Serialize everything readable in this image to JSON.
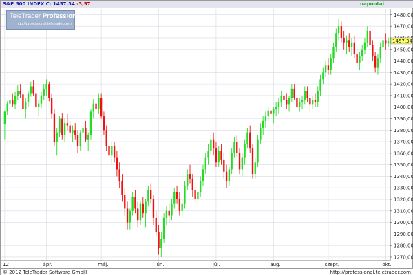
{
  "header": {
    "instrument": "S&P 500 INDEX",
    "close_prefix": "C: 1457,34",
    "change": "-3,57",
    "period": "napontai"
  },
  "logo": {
    "name_light": "TeleTrader",
    "name_bold": "Professional",
    "url": "http://professional.teletrader.com"
  },
  "footer": {
    "copyright": "© 2012 TeleTrader Software GmbH",
    "url": "http://professional.teletrader.com"
  },
  "colors": {
    "up": "#22dd22",
    "down": "#ee1111",
    "grid": "#d8d8e4",
    "last_price_bg": "#ffff66"
  },
  "chart_data": {
    "type": "candlestick",
    "ylim": [
      1267,
      1485
    ],
    "y_ticks": [
      1270,
      1280,
      1290,
      1300,
      1310,
      1320,
      1330,
      1340,
      1350,
      1360,
      1370,
      1380,
      1390,
      1400,
      1410,
      1420,
      1430,
      1440,
      1450,
      1460,
      1470,
      1480
    ],
    "y_tick_labels": [
      "1270,00",
      "1280,00",
      "1290,00",
      "1300,00",
      "1310,00",
      "1320,00",
      "1330,00",
      "1340,00",
      "1350,00",
      "1360,00",
      "1370,00",
      "1380,00",
      "1390,00",
      "1400,00",
      "1410,00",
      "1420,00",
      "1430,00",
      "1440,00",
      "1450,00",
      "1460,00",
      "1470,00",
      "1480,00"
    ],
    "x_months": [
      {
        "label": "12",
        "index": 0
      },
      {
        "label": "ápr.",
        "index": 16
      },
      {
        "label": "máj.",
        "index": 37
      },
      {
        "label": "jún.",
        "index": 59
      },
      {
        "label": "júl.",
        "index": 81
      },
      {
        "label": "aug.",
        "index": 103
      },
      {
        "label": "szept.",
        "index": 124
      },
      {
        "label": "okt.",
        "index": 146
      }
    ],
    "last_price": 1457.34,
    "last_price_label": "1457,34",
    "candles": [
      [
        1385,
        1397,
        1372,
        1396
      ],
      [
        1396,
        1405,
        1393,
        1403
      ],
      [
        1403,
        1409,
        1399,
        1406
      ],
      [
        1406,
        1412,
        1400,
        1402
      ],
      [
        1402,
        1413,
        1398,
        1410
      ],
      [
        1410,
        1419,
        1406,
        1414
      ],
      [
        1414,
        1420,
        1408,
        1411
      ],
      [
        1411,
        1416,
        1396,
        1398
      ],
      [
        1398,
        1408,
        1390,
        1404
      ],
      [
        1404,
        1414,
        1400,
        1412
      ],
      [
        1412,
        1422,
        1409,
        1418
      ],
      [
        1418,
        1423,
        1410,
        1412
      ],
      [
        1412,
        1418,
        1398,
        1400
      ],
      [
        1400,
        1406,
        1392,
        1403
      ],
      [
        1403,
        1413,
        1399,
        1410
      ],
      [
        1410,
        1420,
        1406,
        1416
      ],
      [
        1416,
        1424,
        1410,
        1420
      ],
      [
        1420,
        1422,
        1405,
        1408
      ],
      [
        1408,
        1412,
        1390,
        1394
      ],
      [
        1394,
        1398,
        1366,
        1370
      ],
      [
        1370,
        1382,
        1358,
        1378
      ],
      [
        1378,
        1392,
        1374,
        1390
      ],
      [
        1390,
        1395,
        1372,
        1376
      ],
      [
        1376,
        1390,
        1370,
        1386
      ],
      [
        1386,
        1394,
        1380,
        1384
      ],
      [
        1384,
        1388,
        1374,
        1378
      ],
      [
        1378,
        1384,
        1370,
        1380
      ],
      [
        1380,
        1386,
        1372,
        1376
      ],
      [
        1376,
        1380,
        1360,
        1366
      ],
      [
        1366,
        1380,
        1362,
        1378
      ],
      [
        1378,
        1386,
        1374,
        1382
      ],
      [
        1382,
        1388,
        1370,
        1372
      ],
      [
        1372,
        1378,
        1362,
        1376
      ],
      [
        1376,
        1398,
        1372,
        1396
      ],
      [
        1396,
        1407,
        1390,
        1403
      ],
      [
        1403,
        1410,
        1395,
        1398
      ],
      [
        1398,
        1412,
        1394,
        1408
      ],
      [
        1408,
        1412,
        1390,
        1392
      ],
      [
        1392,
        1396,
        1376,
        1380
      ],
      [
        1380,
        1384,
        1362,
        1366
      ],
      [
        1366,
        1372,
        1352,
        1358
      ],
      [
        1358,
        1370,
        1350,
        1366
      ],
      [
        1366,
        1370,
        1352,
        1356
      ],
      [
        1356,
        1362,
        1340,
        1346
      ],
      [
        1346,
        1352,
        1330,
        1336
      ],
      [
        1336,
        1342,
        1318,
        1324
      ],
      [
        1324,
        1330,
        1306,
        1312
      ],
      [
        1312,
        1318,
        1294,
        1300
      ],
      [
        1300,
        1312,
        1294,
        1310
      ],
      [
        1310,
        1326,
        1306,
        1322
      ],
      [
        1322,
        1328,
        1308,
        1312
      ],
      [
        1312,
        1318,
        1296,
        1302
      ],
      [
        1302,
        1318,
        1298,
        1316
      ],
      [
        1316,
        1322,
        1304,
        1308
      ],
      [
        1308,
        1320,
        1296,
        1318
      ],
      [
        1318,
        1332,
        1314,
        1328
      ],
      [
        1328,
        1334,
        1316,
        1320
      ],
      [
        1320,
        1324,
        1298,
        1304
      ],
      [
        1304,
        1310,
        1288,
        1292
      ],
      [
        1292,
        1298,
        1272,
        1278
      ],
      [
        1278,
        1292,
        1270,
        1286
      ],
      [
        1286,
        1308,
        1282,
        1304
      ],
      [
        1304,
        1314,
        1298,
        1310
      ],
      [
        1310,
        1316,
        1300,
        1306
      ],
      [
        1306,
        1320,
        1302,
        1316
      ],
      [
        1316,
        1330,
        1312,
        1326
      ],
      [
        1326,
        1332,
        1316,
        1320
      ],
      [
        1320,
        1326,
        1306,
        1310
      ],
      [
        1310,
        1320,
        1304,
        1316
      ],
      [
        1316,
        1336,
        1312,
        1332
      ],
      [
        1332,
        1346,
        1328,
        1342
      ],
      [
        1342,
        1350,
        1334,
        1338
      ],
      [
        1338,
        1342,
        1322,
        1328
      ],
      [
        1328,
        1334,
        1316,
        1320
      ],
      [
        1320,
        1328,
        1310,
        1326
      ],
      [
        1326,
        1340,
        1322,
        1336
      ],
      [
        1336,
        1350,
        1332,
        1346
      ],
      [
        1346,
        1360,
        1342,
        1356
      ],
      [
        1356,
        1368,
        1350,
        1362
      ],
      [
        1362,
        1376,
        1358,
        1372
      ],
      [
        1372,
        1378,
        1358,
        1364
      ],
      [
        1364,
        1370,
        1348,
        1352
      ],
      [
        1352,
        1366,
        1348,
        1362
      ],
      [
        1362,
        1368,
        1350,
        1354
      ],
      [
        1354,
        1360,
        1338,
        1344
      ],
      [
        1344,
        1350,
        1330,
        1336
      ],
      [
        1336,
        1348,
        1332,
        1346
      ],
      [
        1346,
        1364,
        1342,
        1360
      ],
      [
        1360,
        1374,
        1356,
        1370
      ],
      [
        1370,
        1376,
        1356,
        1360
      ],
      [
        1360,
        1364,
        1342,
        1346
      ],
      [
        1346,
        1360,
        1340,
        1356
      ],
      [
        1356,
        1372,
        1350,
        1368
      ],
      [
        1368,
        1382,
        1364,
        1378
      ],
      [
        1378,
        1384,
        1360,
        1364
      ],
      [
        1364,
        1368,
        1338,
        1342
      ],
      [
        1342,
        1356,
        1338,
        1352
      ],
      [
        1352,
        1376,
        1348,
        1372
      ],
      [
        1372,
        1386,
        1368,
        1382
      ],
      [
        1382,
        1392,
        1376,
        1388
      ],
      [
        1388,
        1396,
        1382,
        1392
      ],
      [
        1392,
        1400,
        1388,
        1397
      ],
      [
        1397,
        1402,
        1390,
        1394
      ],
      [
        1394,
        1400,
        1386,
        1398
      ],
      [
        1398,
        1404,
        1392,
        1400
      ],
      [
        1400,
        1408,
        1394,
        1404
      ],
      [
        1404,
        1414,
        1400,
        1410
      ],
      [
        1410,
        1416,
        1402,
        1406
      ],
      [
        1406,
        1412,
        1398,
        1402
      ],
      [
        1402,
        1410,
        1396,
        1408
      ],
      [
        1408,
        1420,
        1404,
        1416
      ],
      [
        1416,
        1420,
        1406,
        1408
      ],
      [
        1408,
        1412,
        1396,
        1400
      ],
      [
        1400,
        1408,
        1396,
        1404
      ],
      [
        1404,
        1410,
        1398,
        1406
      ],
      [
        1406,
        1418,
        1402,
        1414
      ],
      [
        1414,
        1418,
        1404,
        1408
      ],
      [
        1408,
        1412,
        1396,
        1402
      ],
      [
        1402,
        1410,
        1398,
        1406
      ],
      [
        1406,
        1412,
        1400,
        1404
      ],
      [
        1404,
        1418,
        1400,
        1414
      ],
      [
        1414,
        1428,
        1410,
        1424
      ],
      [
        1424,
        1434,
        1420,
        1430
      ],
      [
        1430,
        1440,
        1426,
        1436
      ],
      [
        1436,
        1442,
        1428,
        1432
      ],
      [
        1432,
        1446,
        1428,
        1442
      ],
      [
        1442,
        1456,
        1438,
        1452
      ],
      [
        1452,
        1468,
        1448,
        1464
      ],
      [
        1464,
        1476,
        1458,
        1470
      ],
      [
        1470,
        1474,
        1456,
        1460
      ],
      [
        1460,
        1466,
        1450,
        1456
      ],
      [
        1456,
        1462,
        1446,
        1458
      ],
      [
        1458,
        1464,
        1448,
        1452
      ],
      [
        1452,
        1460,
        1444,
        1456
      ],
      [
        1456,
        1462,
        1442,
        1446
      ],
      [
        1446,
        1452,
        1434,
        1438
      ],
      [
        1438,
        1448,
        1432,
        1444
      ],
      [
        1444,
        1454,
        1440,
        1450
      ],
      [
        1450,
        1460,
        1446,
        1456
      ],
      [
        1456,
        1470,
        1452,
        1466
      ],
      [
        1466,
        1472,
        1450,
        1454
      ],
      [
        1454,
        1458,
        1440,
        1444
      ],
      [
        1444,
        1448,
        1430,
        1434
      ],
      [
        1434,
        1446,
        1428,
        1442
      ],
      [
        1442,
        1456,
        1438,
        1452
      ],
      [
        1452,
        1462,
        1448,
        1458
      ],
      [
        1458,
        1464,
        1450,
        1455
      ],
      [
        1455,
        1460,
        1452,
        1457
      ]
    ]
  }
}
